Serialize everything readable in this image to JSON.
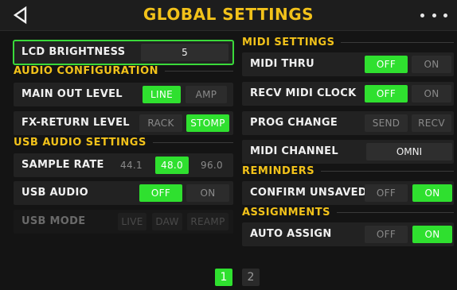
{
  "header": {
    "title": "GLOBAL SETTINGS",
    "back_icon": "back-triangle-icon",
    "more_icon": "more-dots-icon"
  },
  "left": {
    "lcd": {
      "label": "LCD BRIGHTNESS",
      "value": "5"
    },
    "audio_config": {
      "title": "AUDIO CONFIGURATION",
      "main_out": {
        "label": "MAIN OUT LEVEL",
        "options": [
          "LINE",
          "AMP"
        ],
        "selected": "LINE"
      },
      "fx_return": {
        "label": "FX-RETURN LEVEL",
        "options": [
          "RACK",
          "STOMP"
        ],
        "selected": "STOMP"
      }
    },
    "usb_audio_settings": {
      "title": "USB AUDIO SETTINGS",
      "sample_rate": {
        "label": "SAMPLE RATE",
        "options": [
          "44.1",
          "48.0",
          "96.0"
        ],
        "selected": "48.0"
      },
      "usb_audio": {
        "label": "USB AUDIO",
        "options": [
          "OFF",
          "ON"
        ],
        "selected": "OFF"
      },
      "usb_mode": {
        "label": "USB MODE",
        "options": [
          "LIVE",
          "DAW",
          "REAMP"
        ],
        "disabled": true
      }
    }
  },
  "right": {
    "midi_settings": {
      "title": "MIDI SETTINGS",
      "midi_thru": {
        "label": "MIDI THRU",
        "options": [
          "OFF",
          "ON"
        ],
        "selected": "OFF"
      },
      "recv_clock": {
        "label": "RECV MIDI CLOCK",
        "options": [
          "OFF",
          "ON"
        ],
        "selected": "OFF"
      },
      "prog_change": {
        "label": "PROG CHANGE",
        "options": [
          "SEND",
          "RECV"
        ],
        "selected": ""
      },
      "midi_channel": {
        "label": "MIDI CHANNEL",
        "value": "OMNI"
      }
    },
    "reminders": {
      "title": "REMINDERS",
      "confirm_unsaved": {
        "label": "CONFIRM UNSAVED",
        "options": [
          "OFF",
          "ON"
        ],
        "selected": "ON"
      }
    },
    "assignments": {
      "title": "ASSIGNMENTS",
      "auto_assign": {
        "label": "AUTO ASSIGN",
        "options": [
          "OFF",
          "ON"
        ],
        "selected": "ON"
      }
    }
  },
  "pager": {
    "pages": [
      "1",
      "2"
    ],
    "current": "1"
  },
  "colors": {
    "accent": "#f2c21a",
    "selected": "#2fe02f",
    "background": "#141414"
  }
}
